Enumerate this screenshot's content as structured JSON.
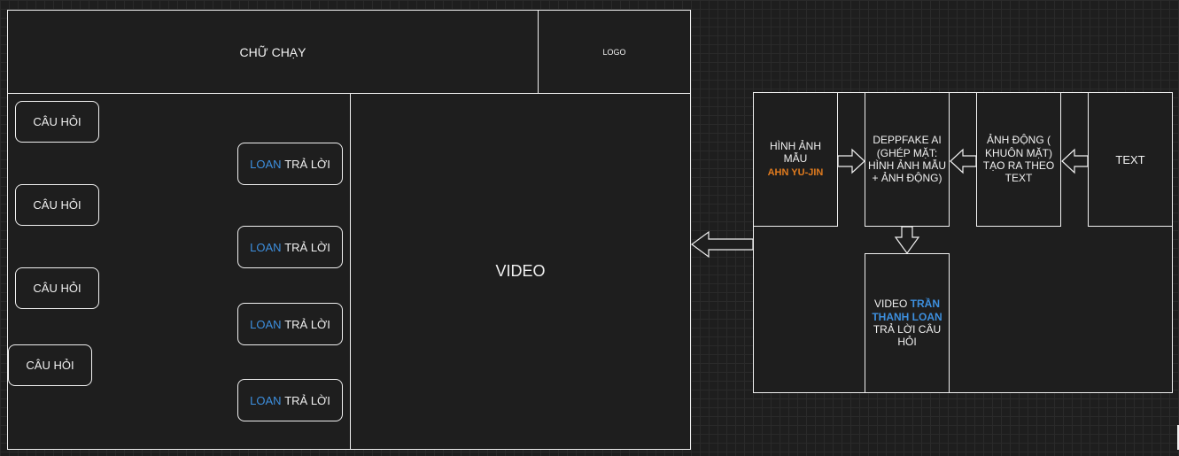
{
  "mockup": {
    "marquee_label": "CHỮ CHẠY",
    "logo_label": "LOGO",
    "video_label": "VIDEO",
    "questions": [
      "CÂU HỎI",
      "CÂU HỎI",
      "CÂU HỎI",
      "CÂU HỎI"
    ],
    "answers": [
      {
        "name": "LOAN",
        "action": "TRẢ LỜI"
      },
      {
        "name": "LOAN",
        "action": "TRẢ LỜI"
      },
      {
        "name": "LOAN",
        "action": "TRẢ LỜI"
      },
      {
        "name": "LOAN",
        "action": "TRẢ LỜI"
      }
    ]
  },
  "pipeline": {
    "sample_image": {
      "label": "HÌNH ẢNH MẪU",
      "person": "AHN YU-JIN"
    },
    "deepfake": {
      "label": "DEPPFAKE AI (GHÉP MẶT: HÌNH ẢNH MẪU + ẢNH ĐỘNG)"
    },
    "animation": {
      "label": "ẢNH ĐỘNG ( KHUÔN MẶT) TẠO RA THEO TEXT"
    },
    "text": {
      "label": "TEXT"
    },
    "output_video": {
      "prefix": "VIDEO",
      "person": "TRẦN THANH LOAN",
      "suffix": "TRẢ LỜI CÂU HỎI"
    }
  },
  "colors": {
    "background": "#1e1e1e",
    "stroke": "#f0f0f0",
    "highlight_blue": "#3d8fde",
    "highlight_orange": "#e07b1f"
  }
}
